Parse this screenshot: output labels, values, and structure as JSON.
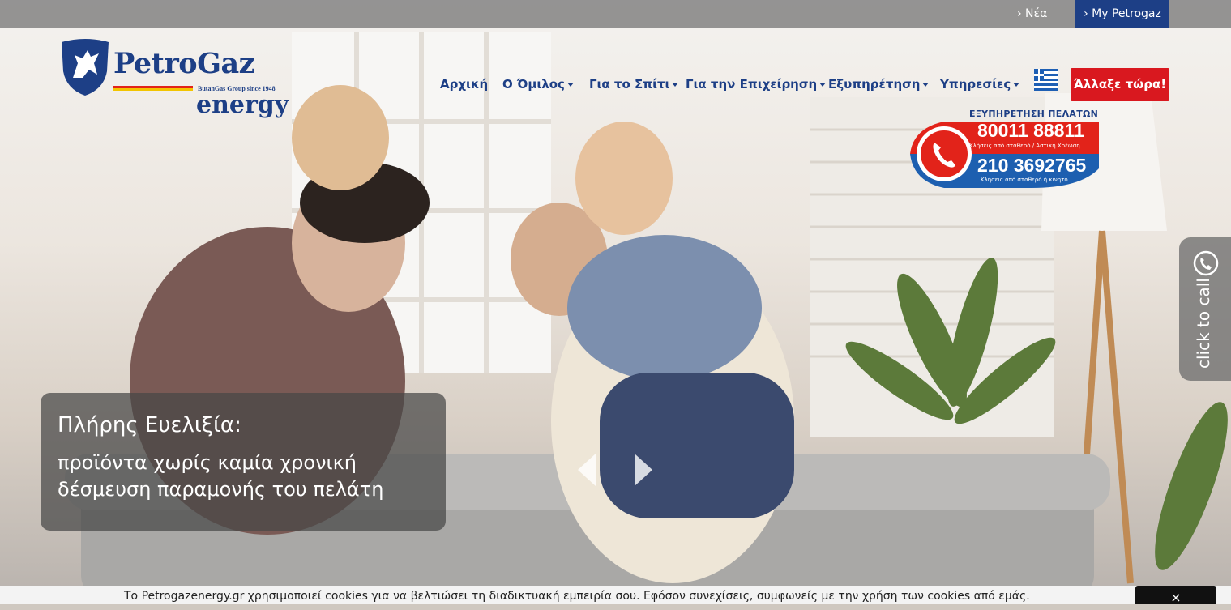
{
  "topbar": {
    "news_label": "› Νέα",
    "my_account_label": "› My Petrogaz"
  },
  "logo": {
    "name": "PetroGaz",
    "tagline": "ButanGas Group since 1948",
    "subtitle": "energy"
  },
  "nav": {
    "items": [
      {
        "label": "Αρχική",
        "dropdown": false
      },
      {
        "label": "Ο Όμιλος",
        "dropdown": true
      },
      {
        "label": "Για το Σπίτι",
        "dropdown": true
      },
      {
        "label": "Για την Επιχείρηση",
        "dropdown": true
      },
      {
        "label": "Εξυπηρέτηση",
        "dropdown": true
      },
      {
        "label": "Υπηρεσίες",
        "dropdown": true
      }
    ],
    "language_icon": "greek-flag-icon",
    "cta_label": "Άλλαξε τώρα!"
  },
  "support": {
    "heading": "ΕΞΥΠΗΡΕΤΗΣΗ ΠΕΛΑΤΩΝ",
    "phone1": "80011 88811",
    "phone1_note": "Κλήσεις από σταθερό / Αστική Χρέωση",
    "phone2": "210 3692765",
    "phone2_note": "Κλήσεις από σταθερό ή κινητό"
  },
  "slide": {
    "title": "Πλήρης Ευελιξία:",
    "text": "προϊόντα χωρίς καμία χρονική δέσμευση παραμονής του πελάτη"
  },
  "call_tab": {
    "label": "click to call"
  },
  "cookie": {
    "text": "Το Petrogazenergy.gr χρησιμοποιεί cookies για να βελτιώσει τη διαδικτυακή εμπειρία σου. Εφόσον συνεχίσεις, συμφωνείς με την χρήση των cookies από εμάς.",
    "close_label": "×"
  },
  "colors": {
    "brand_blue": "#1d3f86",
    "cta_red": "#d9181f",
    "badge_red": "#e2231a"
  }
}
